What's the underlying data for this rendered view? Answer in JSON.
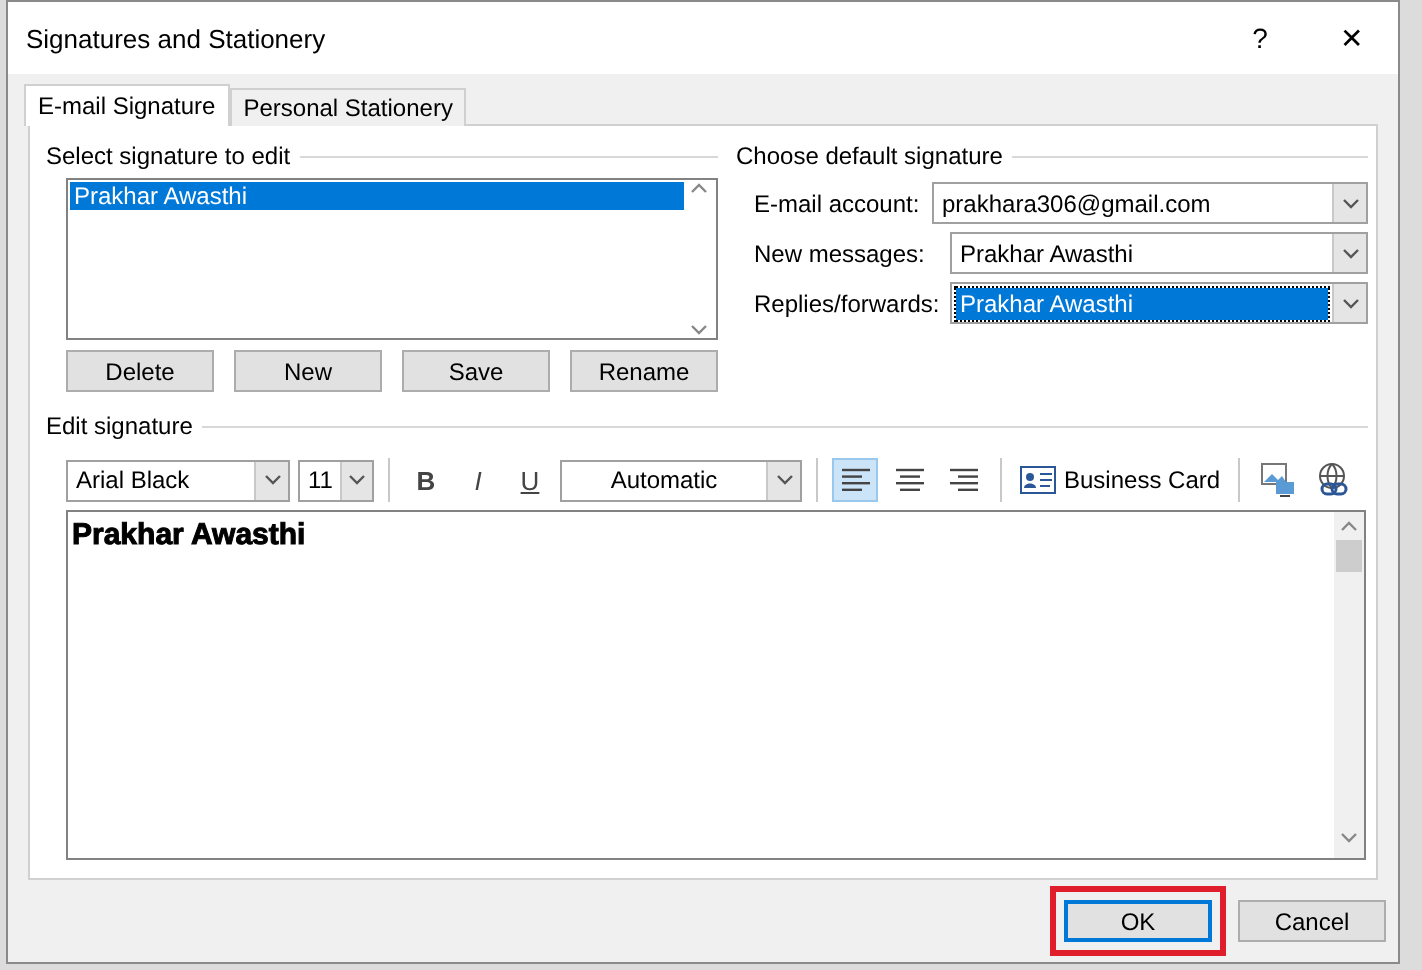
{
  "window": {
    "title": "Signatures and Stationery",
    "help": "?",
    "close": "✕"
  },
  "tabs": [
    {
      "label": "E-mail Signature",
      "selected": true
    },
    {
      "label": "Personal Stationery",
      "selected": false
    }
  ],
  "signature_list": {
    "label": "Select signature to edit",
    "items": [
      {
        "name": "Prakhar Awasthi",
        "selected": true
      }
    ]
  },
  "signature_buttons": [
    "Delete",
    "New",
    "Save",
    "Rename"
  ],
  "default_signature": {
    "label": "Choose default signature",
    "fields": [
      {
        "label": "E-mail account:",
        "value": "prakhara306@gmail.com",
        "selected": false
      },
      {
        "label": "New messages:",
        "value": "Prakhar Awasthi",
        "selected": false
      },
      {
        "label": "Replies/forwards:",
        "value": "Prakhar Awasthi",
        "selected": true
      }
    ]
  },
  "editor": {
    "label": "Edit signature",
    "font": "Arial Black",
    "size": "11",
    "formatting": [
      {
        "kind": "bold",
        "label": "B"
      },
      {
        "kind": "italic",
        "label": "I"
      },
      {
        "kind": "underline",
        "label": "U"
      }
    ],
    "color_choice": "Automatic",
    "alignment": [
      {
        "kind": "left",
        "selected": true
      },
      {
        "kind": "center",
        "selected": false
      },
      {
        "kind": "right",
        "selected": false
      }
    ],
    "business_card": "Business Card",
    "text": "Prakhar Awasthi"
  },
  "dialog_buttons": [
    {
      "label": "OK",
      "default": true,
      "highlighted": true
    },
    {
      "label": "Cancel",
      "default": false,
      "highlighted": false
    }
  ]
}
